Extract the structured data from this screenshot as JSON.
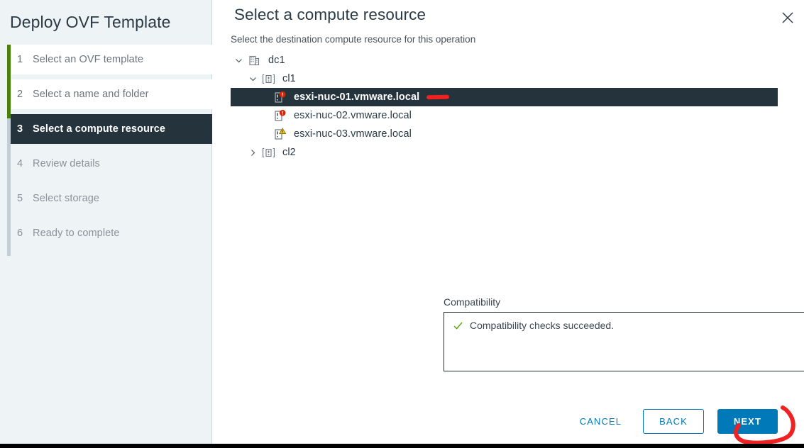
{
  "wizard": {
    "title": "Deploy OVF Template",
    "close_icon": "close-icon",
    "steps": [
      {
        "num": "1",
        "label": "Select an OVF template",
        "state": "done"
      },
      {
        "num": "2",
        "label": "Select a name and folder",
        "state": "done"
      },
      {
        "num": "3",
        "label": "Select a compute resource",
        "state": "active"
      },
      {
        "num": "4",
        "label": "Review details",
        "state": "pending"
      },
      {
        "num": "5",
        "label": "Select storage",
        "state": "pending"
      },
      {
        "num": "6",
        "label": "Ready to complete",
        "state": "pending"
      }
    ]
  },
  "page": {
    "title": "Select a compute resource",
    "subtitle": "Select the destination compute resource for this operation"
  },
  "tree": {
    "nodes": [
      {
        "label": "dc1",
        "icon": "datacenter-icon",
        "twisty": "chevron-down-icon",
        "indent": 0,
        "selected": false,
        "badge": ""
      },
      {
        "label": "cl1",
        "icon": "cluster-icon",
        "twisty": "chevron-down-icon",
        "indent": 1,
        "selected": false,
        "badge": ""
      },
      {
        "label": "esxi-nuc-01.vmware.local",
        "icon": "host-icon",
        "twisty": "none",
        "indent": 2,
        "selected": true,
        "badge": "error-badge"
      },
      {
        "label": "esxi-nuc-02.vmware.local",
        "icon": "host-icon",
        "twisty": "none",
        "indent": 2,
        "selected": false,
        "badge": "error-badge"
      },
      {
        "label": "esxi-nuc-03.vmware.local",
        "icon": "host-icon",
        "twisty": "none",
        "indent": 2,
        "selected": false,
        "badge": "warning-badge"
      },
      {
        "label": "cl2",
        "icon": "cluster-icon",
        "twisty": "chevron-right-icon",
        "indent": 1,
        "selected": false,
        "badge": ""
      }
    ]
  },
  "compatibility": {
    "label": "Compatibility",
    "status_icon": "check-icon",
    "message": "Compatibility checks succeeded."
  },
  "footer": {
    "cancel_label": "CANCEL",
    "back_label": "BACK",
    "next_label": "NEXT"
  },
  "annotations": {
    "host_marker_color": "#ee2222",
    "next_circle_color": "#ee2222"
  },
  "colors": {
    "sidebar_bg": "#eef3f6",
    "active_step_bg": "#25333d",
    "progress_done": "#48820b",
    "progress_pending": "#c3ced4",
    "primary_blue": "#0079b8",
    "success_green": "#60a917",
    "error_red": "#e02200",
    "warning_yellow": "#f2c211"
  }
}
